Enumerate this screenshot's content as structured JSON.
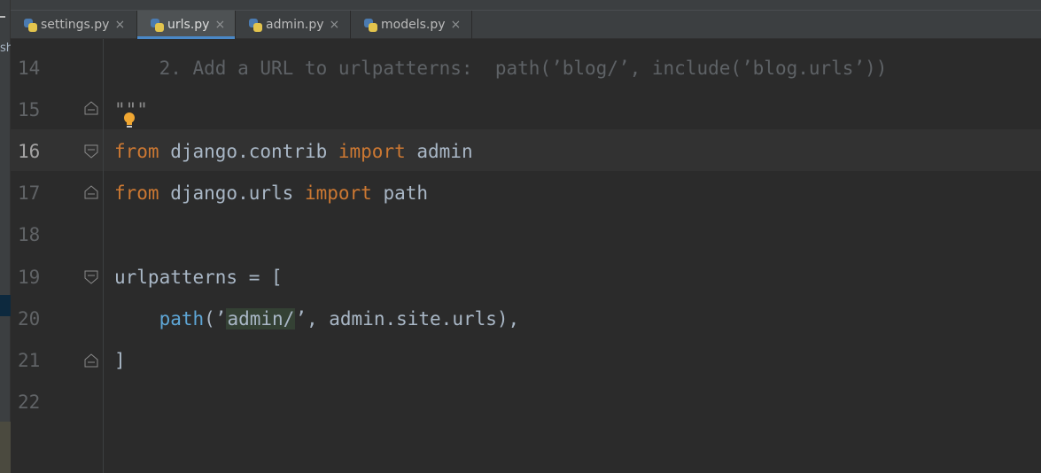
{
  "left_strip": {
    "cut_label": "sh"
  },
  "tabs": [
    {
      "label": "settings.py",
      "icon": "python-file-icon",
      "active": false
    },
    {
      "label": "urls.py",
      "icon": "python-file-icon",
      "active": true
    },
    {
      "label": "admin.py",
      "icon": "python-file-icon",
      "active": false
    },
    {
      "label": "models.py",
      "icon": "python-file-icon",
      "active": false
    }
  ],
  "close_glyph": "×",
  "editor": {
    "current_line": "16",
    "lines": [
      {
        "no": "14"
      },
      {
        "no": "15"
      },
      {
        "no": "16"
      },
      {
        "no": "17"
      },
      {
        "no": "18"
      },
      {
        "no": "19"
      },
      {
        "no": "20"
      },
      {
        "no": "21"
      },
      {
        "no": "22"
      }
    ],
    "code": {
      "l14_comment": "    2. Add a URL to urlpatterns:  path(’blog/’, include(’blog.urls’))",
      "l15_docend": "\"\"\"",
      "l16_from": "from",
      "l16_module": " django.contrib ",
      "l16_import": "import",
      "l16_name": " admin",
      "l17_from": "from",
      "l17_module": " django.urls ",
      "l17_import": "import",
      "l17_name": " path",
      "l19_text": "urlpatterns = [",
      "l20_indent": "    ",
      "l20_call": "path",
      "l20_open": "(’",
      "l20_str": "admin/",
      "l20_rest": "’, admin.site.urls),",
      "l21_text": "]"
    }
  },
  "colors": {
    "background": "#2b2b2b",
    "keyword": "#cc7832",
    "comment": "#5e6266",
    "text": "#a9b7c6",
    "line_number": "#606366",
    "active_tab_underline": "#4a88c7"
  }
}
